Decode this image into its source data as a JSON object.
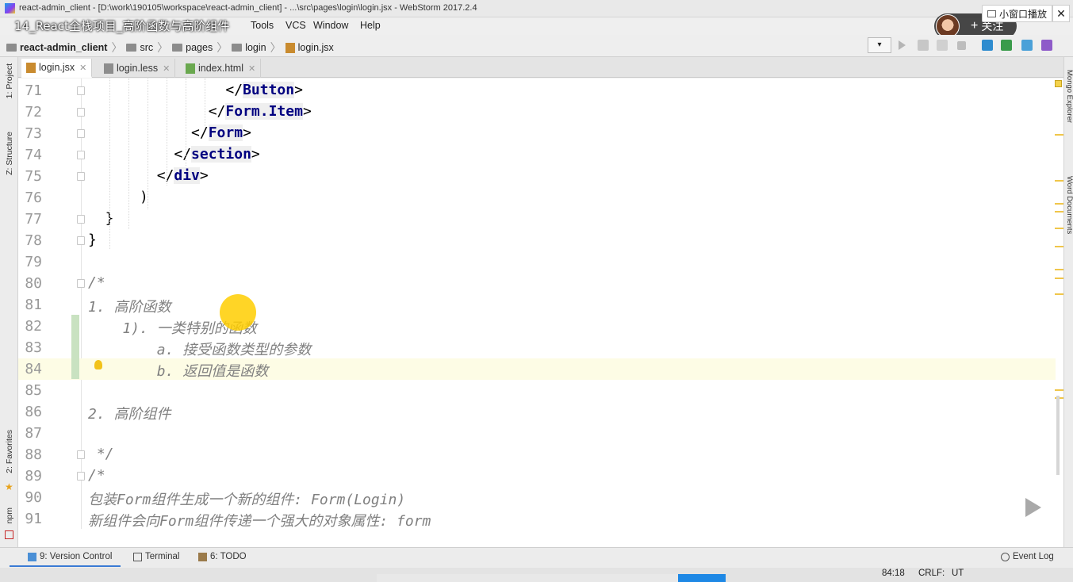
{
  "window": {
    "title": "react-admin_client - [D:\\work\\190105\\workspace\\react-admin_client] - ...\\src\\pages\\login\\login.jsx - WebStorm 2017.2.4"
  },
  "video": {
    "title": "14_React全栈项目_高阶函数与高阶组件",
    "pip_label": "小窗口播放",
    "close_label": "✕",
    "follow_label": "关注"
  },
  "menu": [
    "Tools",
    "VCS",
    "Window",
    "Help"
  ],
  "breadcrumb": [
    "react-admin_client",
    "src",
    "pages",
    "login",
    "login.jsx"
  ],
  "tabs": [
    {
      "label": "login.jsx",
      "active": true
    },
    {
      "label": "login.less",
      "active": false
    },
    {
      "label": "index.html",
      "active": false
    }
  ],
  "left_tools": [
    "1: Project",
    "Z: Structure",
    "2: Favorites",
    "npm"
  ],
  "right_tools": [
    "Mongo Explorer",
    "Word Documents"
  ],
  "editor": {
    "current_line": 84,
    "lines": [
      {
        "n": "71",
        "text": "                </Button>",
        "kind": "tag"
      },
      {
        "n": "72",
        "text": "              </Form.Item>",
        "kind": "tag"
      },
      {
        "n": "73",
        "text": "            </Form>",
        "kind": "tag"
      },
      {
        "n": "74",
        "text": "          </section>",
        "kind": "tag"
      },
      {
        "n": "75",
        "text": "        </div>",
        "kind": "tag"
      },
      {
        "n": "76",
        "text": "      )",
        "kind": "plain"
      },
      {
        "n": "77",
        "text": "  }",
        "kind": "plain"
      },
      {
        "n": "78",
        "text": "}",
        "kind": "plain"
      },
      {
        "n": "79",
        "text": "",
        "kind": "plain"
      },
      {
        "n": "80",
        "text": "/*",
        "kind": "comment"
      },
      {
        "n": "81",
        "text": "1. 高阶函数",
        "kind": "comment"
      },
      {
        "n": "82",
        "text": "    1). 一类特别的函数",
        "kind": "comment"
      },
      {
        "n": "83",
        "text": "        a. 接受函数类型的参数",
        "kind": "comment"
      },
      {
        "n": "84",
        "text": "        b. 返回值是函数",
        "kind": "comment"
      },
      {
        "n": "85",
        "text": "",
        "kind": "plain"
      },
      {
        "n": "86",
        "text": "2. 高阶组件",
        "kind": "comment"
      },
      {
        "n": "87",
        "text": "",
        "kind": "plain"
      },
      {
        "n": "88",
        "text": " */",
        "kind": "comment"
      },
      {
        "n": "89",
        "text": "/*",
        "kind": "comment"
      },
      {
        "n": "90",
        "text": "包装Form组件生成一个新的组件: Form(Login)",
        "kind": "comment"
      },
      {
        "n": "91",
        "text": "新组件会向Form组件传递一个强大的对象属性: form",
        "kind": "comment"
      }
    ]
  },
  "bottom_tools": [
    "9: Version Control",
    "Terminal",
    "6: TODO",
    "Event Log"
  ],
  "status": {
    "position": "84:18",
    "line_sep": "CRLF:",
    "encoding": "UT"
  },
  "colors": {
    "tag": "#000080",
    "comment": "#808080",
    "current_line_bg": "#fdfce5",
    "cursor_dot": "#ffce00"
  }
}
